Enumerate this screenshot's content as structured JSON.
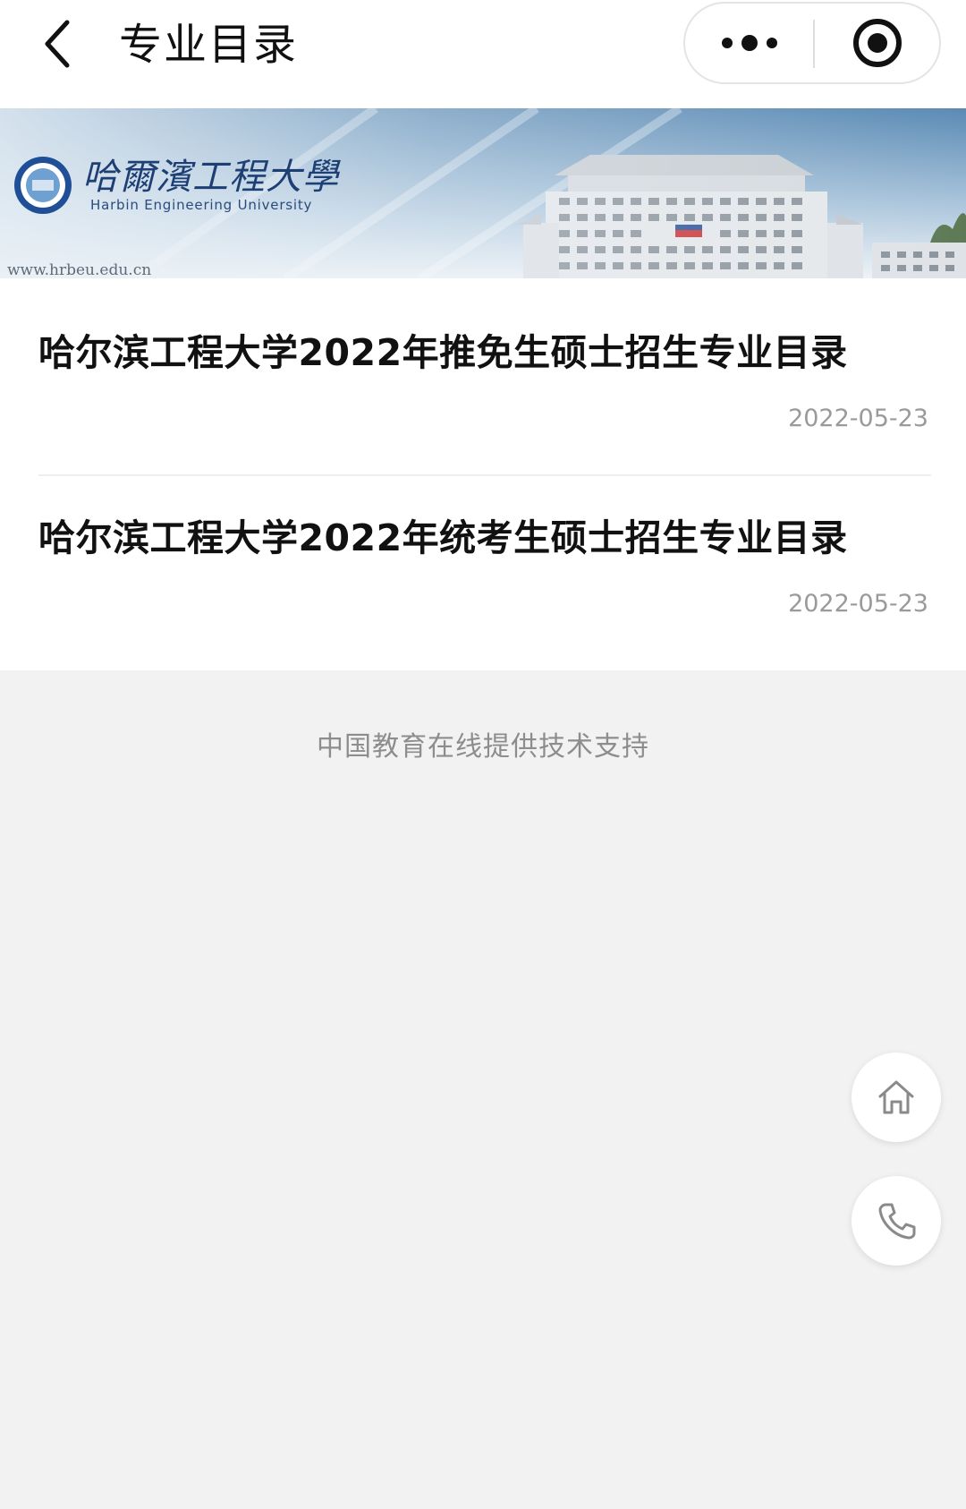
{
  "header": {
    "title": "专业目录",
    "back_icon": "back-chevron-icon",
    "more_icon": "more-dots-icon",
    "close_icon": "record-close-icon"
  },
  "banner": {
    "university_name_cn": "哈爾濱工程大學",
    "university_name_en": "Harbin Engineering University",
    "website": "www.hrbeu.edu.cn",
    "colors": {
      "sky": "#5f8fb8",
      "light": "#e8eff5"
    }
  },
  "articles": [
    {
      "title": "哈尔滨工程大学2022年推免生硕士招生专业目录",
      "date": "2022-05-23"
    },
    {
      "title": "哈尔滨工程大学2022年统考生硕士招生专业目录",
      "date": "2022-05-23"
    }
  ],
  "footer": {
    "support_text": "中国教育在线提供技术支持"
  },
  "floating_actions": [
    {
      "icon": "home-icon"
    },
    {
      "icon": "phone-icon"
    }
  ]
}
